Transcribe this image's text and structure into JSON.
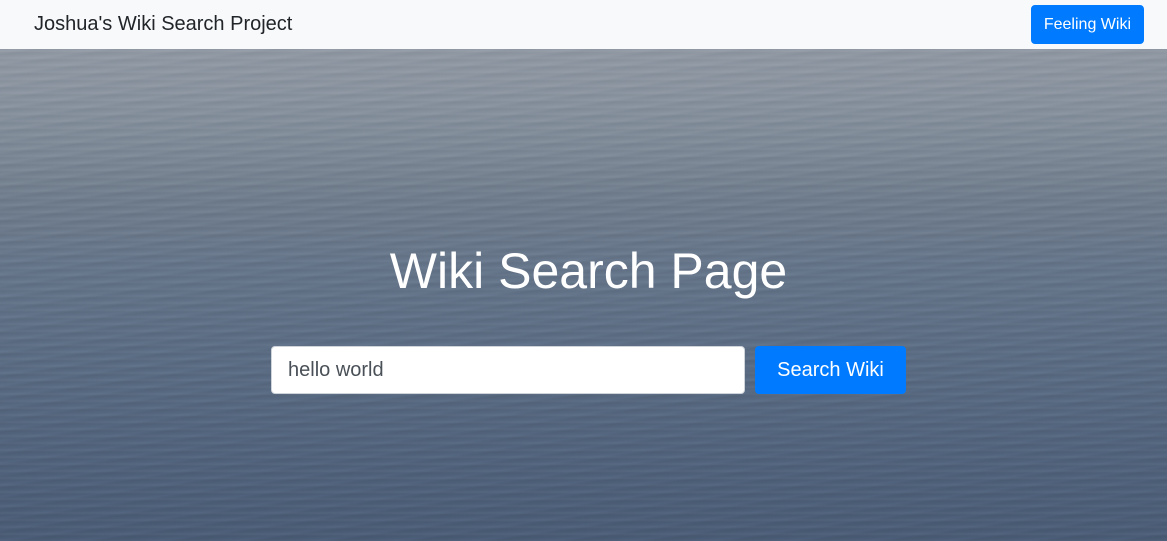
{
  "navbar": {
    "brand": "Joshua's Wiki Search Project",
    "feeling_button_label": "Feeling Wiki"
  },
  "hero": {
    "title": "Wiki Search Page",
    "background_description": "calm ocean water under a hazy sky"
  },
  "search": {
    "input_value": "hello world",
    "button_label": "Search Wiki"
  },
  "colors": {
    "primary": "#007bff",
    "navbar_bg": "#f8f9fa",
    "brand_text": "#212529"
  }
}
